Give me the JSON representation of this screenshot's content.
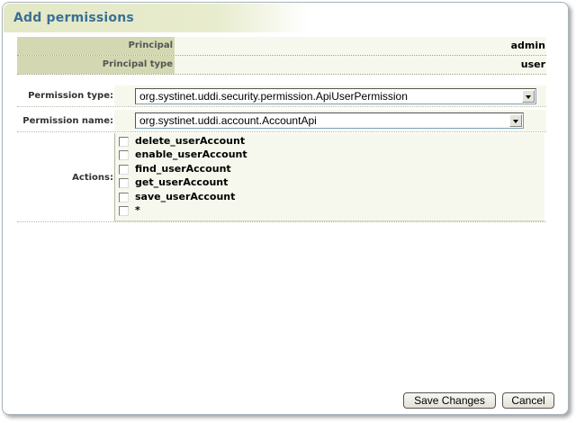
{
  "dialog": {
    "title": "Add permissions"
  },
  "principal": {
    "principal_label": "Principal",
    "principal_value": "admin",
    "type_label": "Principal type",
    "type_value": "user"
  },
  "form": {
    "permission_type_label": "Permission type:",
    "permission_type_value": "org.systinet.uddi.security.permission.ApiUserPermission",
    "permission_name_label": "Permission name:",
    "permission_name_value": "org.systinet.uddi.account.AccountApi",
    "actions_label": "Actions:",
    "actions": [
      {
        "label": "delete_userAccount",
        "checked": false
      },
      {
        "label": "enable_userAccount",
        "checked": false
      },
      {
        "label": "find_userAccount",
        "checked": false
      },
      {
        "label": "get_userAccount",
        "checked": false
      },
      {
        "label": "save_userAccount",
        "checked": false
      },
      {
        "label": "*",
        "checked": false
      }
    ]
  },
  "buttons": {
    "save": "Save Changes",
    "cancel": "Cancel"
  },
  "colors": {
    "title_text": "#3b6f94",
    "label_band": "#d3d8b2",
    "value_band": "#f7f8ed"
  }
}
